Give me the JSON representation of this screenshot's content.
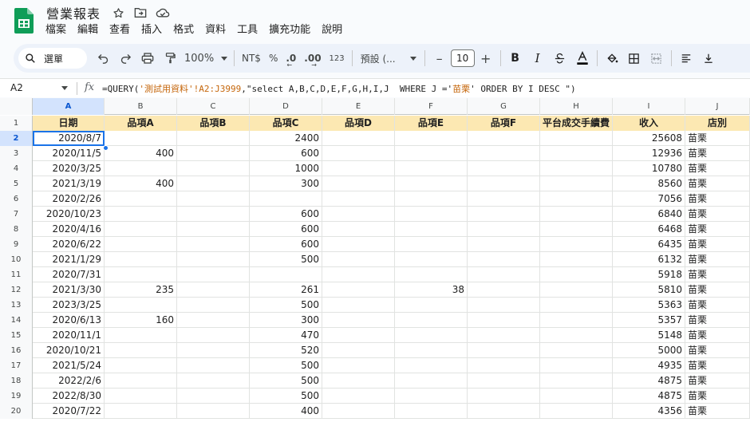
{
  "app": {
    "title": "營業報表",
    "colors": {
      "brand": "#0f9d58",
      "accent": "#1a73e8",
      "header_fill": "#fce8b2"
    }
  },
  "title_icons": [
    "star-icon",
    "move-to-folder-icon",
    "cloud-saved-icon"
  ],
  "menu": [
    "檔案",
    "編輯",
    "查看",
    "插入",
    "格式",
    "資料",
    "工具",
    "擴充功能",
    "說明"
  ],
  "toolbar": {
    "search_label": "選單",
    "zoom": "100%",
    "currency": "NT$",
    "percent": "%",
    "decrease_decimals": ".0",
    "increase_decimals": ".00",
    "number_format": "123",
    "font": "預設 (...",
    "minus": "–",
    "font_size": "10",
    "plus": "+",
    "bold": "B",
    "italic": "I"
  },
  "formula_bar": {
    "cell_ref": "A2",
    "fx": "fx",
    "formula_prefix": "=QUERY(",
    "formula_sheet": "'測試用資料'!A2:J3999",
    "formula_mid": ",\"select A,B,C,D,E,F,G,H,I,J  WHERE J ='",
    "formula_value": "苗栗",
    "formula_suffix": "' ORDER BY I DESC \")"
  },
  "grid": {
    "columns": [
      "A",
      "B",
      "C",
      "D",
      "E",
      "F",
      "G",
      "H",
      "I",
      "J"
    ],
    "header_row": [
      "日期",
      "品項A",
      "品項B",
      "品項C",
      "品項D",
      "品項E",
      "品項F",
      "平台成交手續費",
      "收入",
      "店別"
    ],
    "rows": [
      [
        "2020/8/7",
        "",
        "",
        "2400",
        "",
        "",
        "",
        "",
        "25608",
        "苗栗"
      ],
      [
        "2020/11/5",
        "400",
        "",
        "600",
        "",
        "",
        "",
        "",
        "12936",
        "苗栗"
      ],
      [
        "2020/3/25",
        "",
        "",
        "1000",
        "",
        "",
        "",
        "",
        "10780",
        "苗栗"
      ],
      [
        "2021/3/19",
        "400",
        "",
        "300",
        "",
        "",
        "",
        "",
        "8560",
        "苗栗"
      ],
      [
        "2020/2/26",
        "",
        "",
        "",
        "",
        "",
        "",
        "",
        "7056",
        "苗栗"
      ],
      [
        "2020/10/23",
        "",
        "",
        "600",
        "",
        "",
        "",
        "",
        "6840",
        "苗栗"
      ],
      [
        "2020/4/16",
        "",
        "",
        "600",
        "",
        "",
        "",
        "",
        "6468",
        "苗栗"
      ],
      [
        "2020/6/22",
        "",
        "",
        "600",
        "",
        "",
        "",
        "",
        "6435",
        "苗栗"
      ],
      [
        "2021/1/29",
        "",
        "",
        "500",
        "",
        "",
        "",
        "",
        "6132",
        "苗栗"
      ],
      [
        "2020/7/31",
        "",
        "",
        "",
        "",
        "",
        "",
        "",
        "5918",
        "苗栗"
      ],
      [
        "2021/3/30",
        "235",
        "",
        "261",
        "",
        "38",
        "",
        "",
        "5810",
        "苗栗"
      ],
      [
        "2023/3/25",
        "",
        "",
        "500",
        "",
        "",
        "",
        "",
        "5363",
        "苗栗"
      ],
      [
        "2020/6/13",
        "160",
        "",
        "300",
        "",
        "",
        "",
        "",
        "5357",
        "苗栗"
      ],
      [
        "2020/11/1",
        "",
        "",
        "470",
        "",
        "",
        "",
        "",
        "5148",
        "苗栗"
      ],
      [
        "2020/10/21",
        "",
        "",
        "520",
        "",
        "",
        "",
        "",
        "5000",
        "苗栗"
      ],
      [
        "2021/5/24",
        "",
        "",
        "500",
        "",
        "",
        "",
        "",
        "4935",
        "苗栗"
      ],
      [
        "2022/2/6",
        "",
        "",
        "500",
        "",
        "",
        "",
        "",
        "4875",
        "苗栗"
      ],
      [
        "2022/8/30",
        "",
        "",
        "500",
        "",
        "",
        "",
        "",
        "4875",
        "苗栗"
      ],
      [
        "2020/7/22",
        "",
        "",
        "400",
        "",
        "",
        "",
        "",
        "4356",
        "苗栗"
      ]
    ]
  }
}
